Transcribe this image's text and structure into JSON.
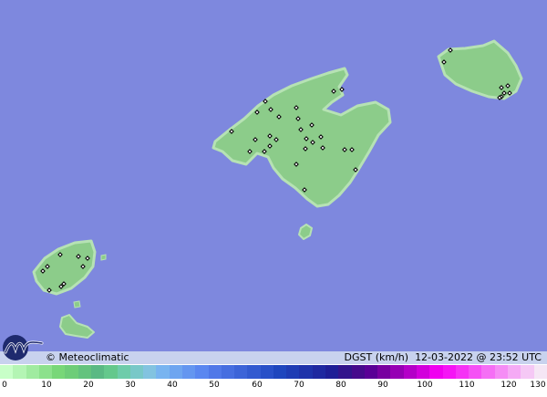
{
  "map": {
    "sea_color": "#7e88de",
    "land_color": "#8ccc8a",
    "land_edge_color": "#b6e2b4",
    "station_marker_color": "#000000"
  },
  "footer": {
    "credit": "© Meteoclimatic",
    "title": "DGST (km/h)  12-03-2022 @ 23:52 UTC",
    "logo_icon": "meteoclimatic-wave-logo"
  },
  "legend": {
    "unit": "km/h",
    "tick_labels": [
      "0",
      "10",
      "20",
      "30",
      "40",
      "50",
      "60",
      "70",
      "80",
      "90",
      "100",
      "110",
      "120",
      "130"
    ],
    "colors": [
      "#c8ffc8",
      "#b4f5b4",
      "#a0eba0",
      "#8ce18c",
      "#78d778",
      "#6ecd78",
      "#64c37e",
      "#5ab984",
      "#64c88c",
      "#6eccaa",
      "#78c8c8",
      "#82c3e0",
      "#78b4f0",
      "#6ea5f0",
      "#6496f0",
      "#5a87f0",
      "#5078e8",
      "#466ee0",
      "#3c64d8",
      "#325ad0",
      "#2850c8",
      "#1e46be",
      "#1e3cb4",
      "#1e32aa",
      "#1e28a0",
      "#1e1e96",
      "#32148c",
      "#460a8c",
      "#5a0096",
      "#7800a0",
      "#9600b4",
      "#b400c8",
      "#d200dc",
      "#f000f0",
      "#f514f5",
      "#f532f5",
      "#f550f5",
      "#f56ef5",
      "#f58cf5",
      "#f5aaf5",
      "#f5c8f5",
      "#f5e6f5"
    ]
  }
}
